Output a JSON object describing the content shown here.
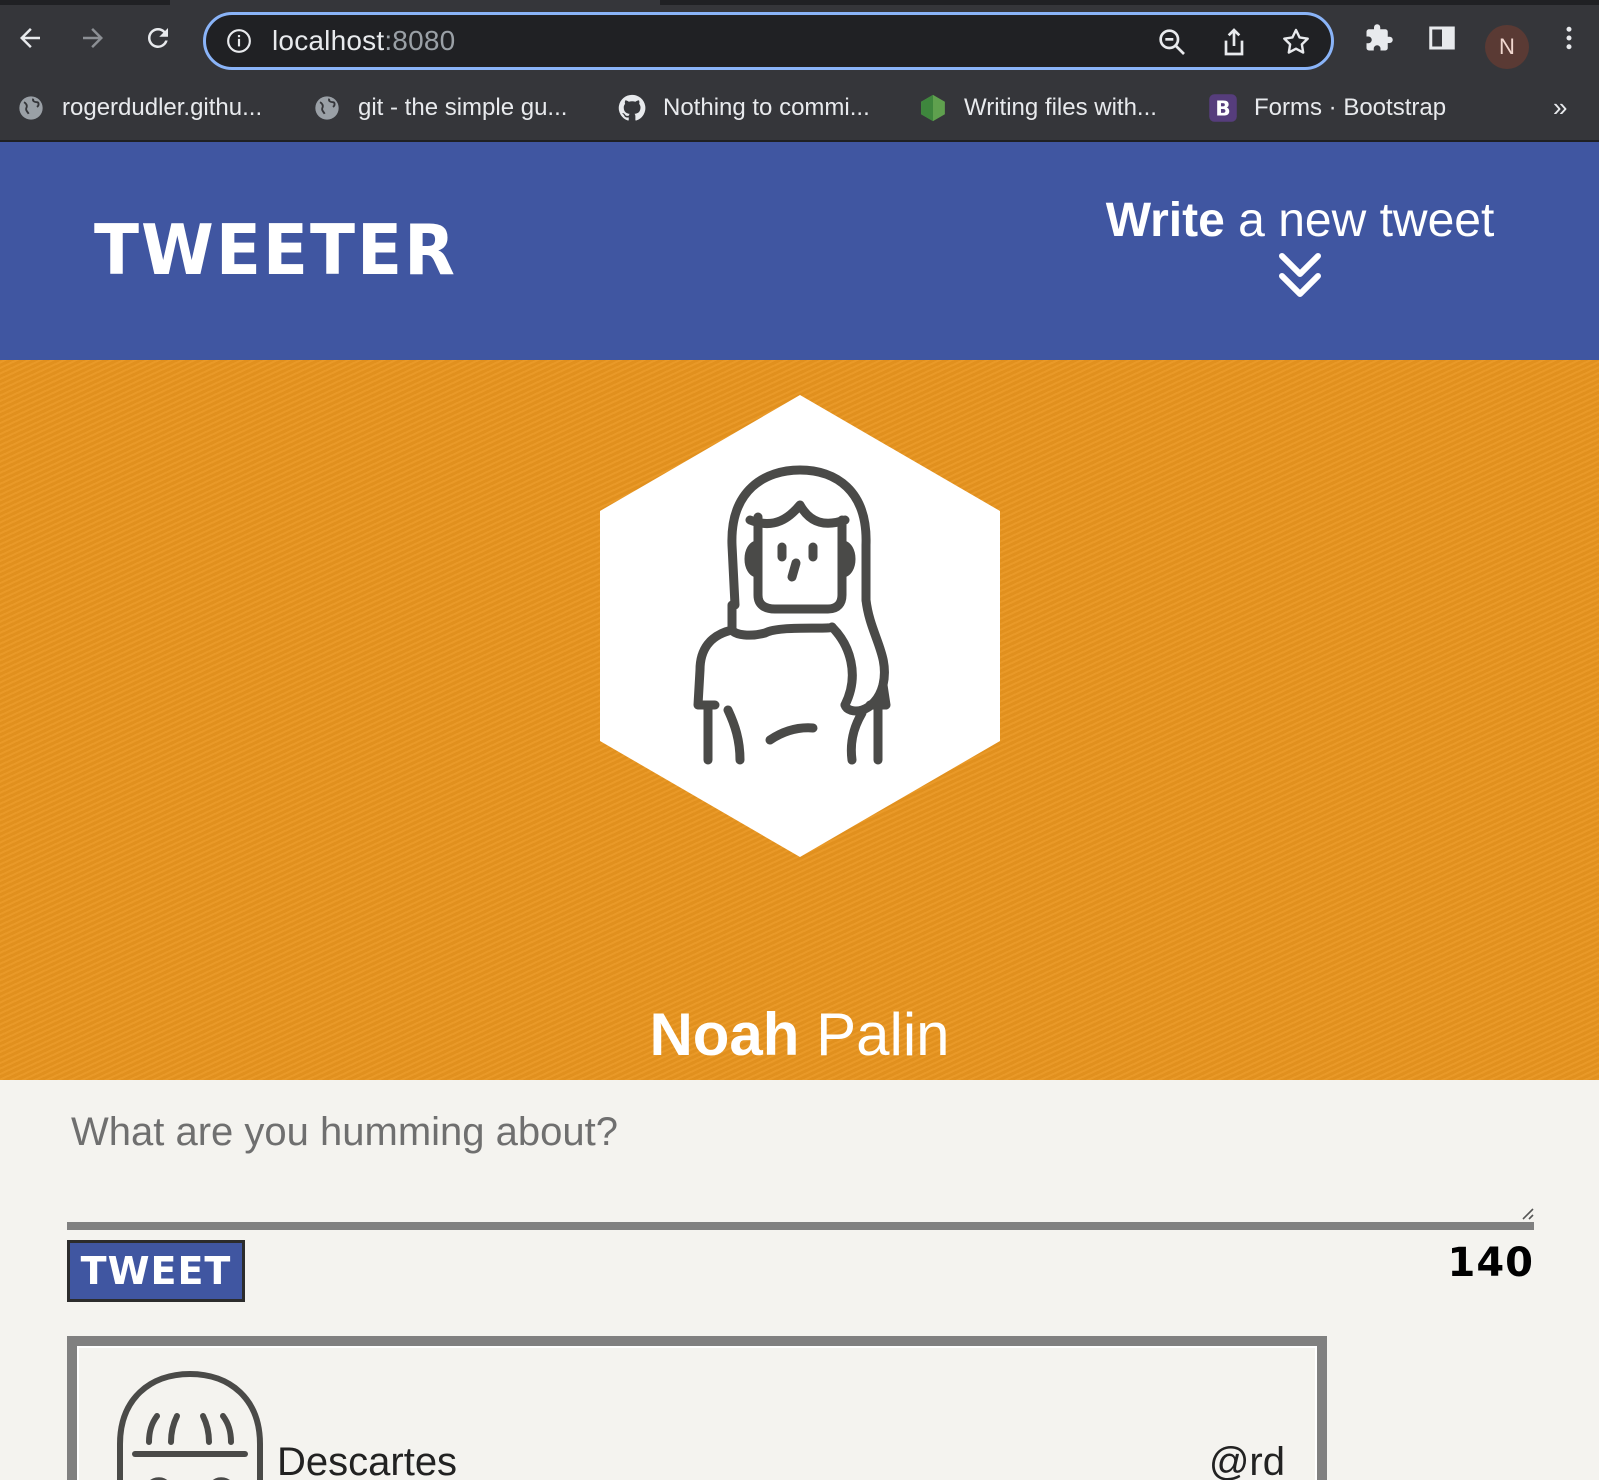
{
  "browser": {
    "url_host": "localhost",
    "url_port": ":8080",
    "profile_initial": "N",
    "bookmarks": [
      {
        "label": "rogerdudler.githu...",
        "icon": "globe-icon"
      },
      {
        "label": "git - the simple gu...",
        "icon": "globe-icon"
      },
      {
        "label": "Nothing to commi...",
        "icon": "github-icon"
      },
      {
        "label": "Writing files with...",
        "icon": "nodejs-icon"
      },
      {
        "label": "Forms · Bootstrap",
        "icon": "bootstrap-icon"
      }
    ],
    "bookmarks_more": "»"
  },
  "header": {
    "brand": "TWEETER",
    "compose_bold": "Write",
    "compose_rest": " a new tweet"
  },
  "profile": {
    "first_name": "Noah",
    "last_name": " Palin"
  },
  "composer": {
    "placeholder": "What are you humming about?",
    "button_label": "TWEET",
    "counter": "140"
  },
  "tweets": [
    {
      "author": "Descartes",
      "handle": "@rd"
    }
  ],
  "colors": {
    "nav": "#4056a1",
    "banner": "#e8951f",
    "page": "#f4f3ef",
    "border": "#808080"
  }
}
